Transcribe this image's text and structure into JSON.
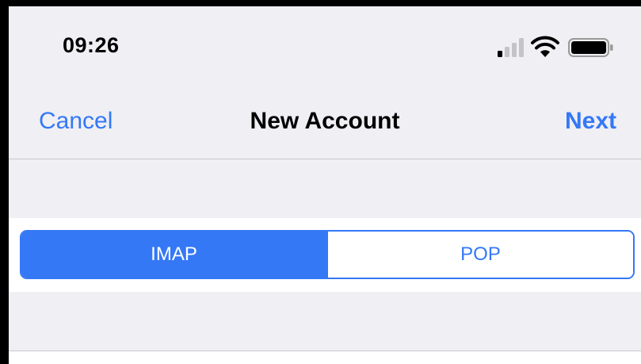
{
  "status_bar": {
    "time": "09:26",
    "icons": [
      "signal-icon",
      "wifi-icon",
      "battery-icon"
    ]
  },
  "nav": {
    "cancel_label": "Cancel",
    "title": "New Account",
    "next_label": "Next"
  },
  "segmented": {
    "options": [
      "IMAP",
      "POP"
    ],
    "selected": "IMAP"
  },
  "colors": {
    "accent": "#3478f6",
    "background": "#efeff4",
    "cell": "#ffffff",
    "separator": "#c8c7cc"
  }
}
